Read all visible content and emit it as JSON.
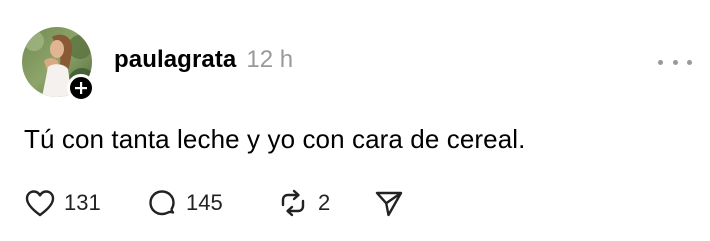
{
  "post": {
    "username": "paulagrata",
    "timestamp": "12 h",
    "text": "Tú con tanta leche y yo con cara de cereal.",
    "likes": "131",
    "replies": "145",
    "reposts": "2"
  },
  "icons": {
    "avatar": "avatar-photo",
    "follow": "plus-icon",
    "more": "ellipsis-icon",
    "like": "heart-icon",
    "reply": "comment-bubble-icon",
    "repost": "repost-icon",
    "share": "send-icon"
  },
  "colors": {
    "text": "#000000",
    "muted": "#999999",
    "background": "#ffffff"
  }
}
